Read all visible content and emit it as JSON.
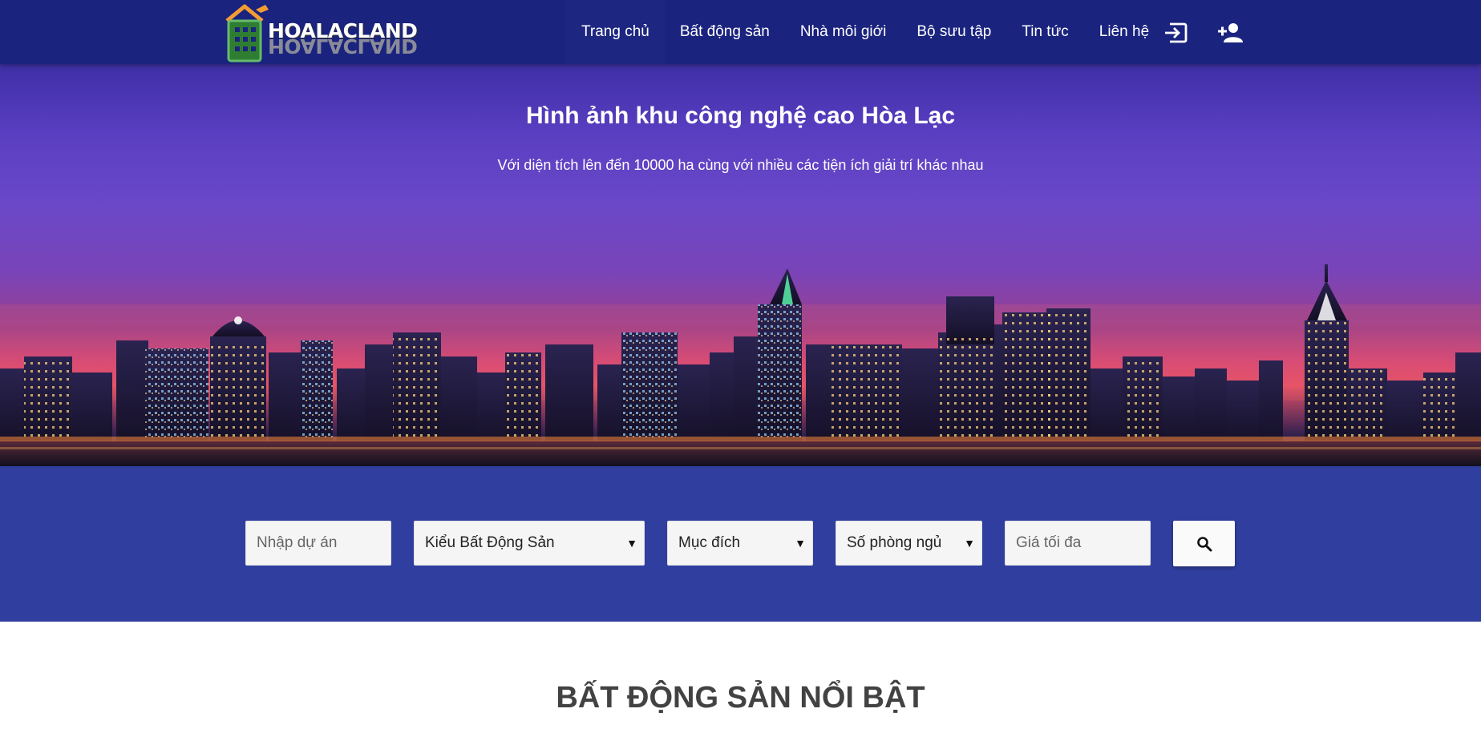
{
  "brand": {
    "name": "HOALACLAND"
  },
  "nav": {
    "items": [
      {
        "label": "Trang chủ",
        "active": true
      },
      {
        "label": "Bất động sản",
        "active": false
      },
      {
        "label": "Nhà môi giới",
        "active": false
      },
      {
        "label": "Bộ sưu tập",
        "active": false
      },
      {
        "label": "Tin tức",
        "active": false
      },
      {
        "label": "Liên hệ",
        "active": false
      }
    ],
    "icons": {
      "login": "login-icon",
      "register": "person-add-icon"
    }
  },
  "hero": {
    "title": "Hình ảnh khu công nghệ cao Hòa Lạc",
    "subtitle": "Với diện tích lên đến 10000 ha cùng với nhiều các tiện ích giải trí khác nhau"
  },
  "search": {
    "project_placeholder": "Nhập dự án",
    "property_type": "Kiểu Bất Động Sản",
    "purpose": "Mục đích",
    "bedrooms": "Số phòng ngủ",
    "max_price_placeholder": "Giá tối đa",
    "button_icon": "search-icon"
  },
  "featured": {
    "title": "BẤT ĐỘNG SẢN NỔI BẬT"
  },
  "colors": {
    "navbar": "#1a237e",
    "search_band": "#303f9f",
    "section_title": "#424242"
  }
}
